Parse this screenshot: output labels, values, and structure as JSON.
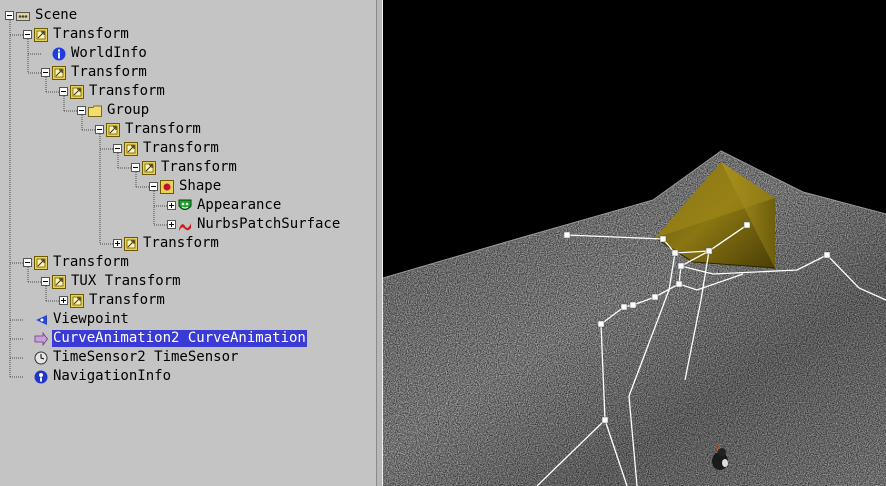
{
  "tree": {
    "nodes": [
      {
        "label": "Scene",
        "icon": "scene-icon",
        "expander": "minus",
        "depth": 0,
        "kind": "scene"
      },
      {
        "label": "Transform",
        "icon": "transform-icon",
        "expander": "minus",
        "depth": 1,
        "kind": "transform"
      },
      {
        "label": "WorldInfo",
        "icon": "info-icon",
        "expander": "none",
        "depth": 2,
        "kind": "info"
      },
      {
        "label": "Transform",
        "icon": "transform-icon",
        "expander": "minus",
        "depth": 2,
        "kind": "transform"
      },
      {
        "label": "Transform",
        "icon": "transform-icon",
        "expander": "minus",
        "depth": 3,
        "kind": "transform"
      },
      {
        "label": "Group",
        "icon": "folder-icon",
        "expander": "minus",
        "depth": 4,
        "kind": "group"
      },
      {
        "label": "Transform",
        "icon": "transform-icon",
        "expander": "minus",
        "depth": 5,
        "kind": "transform"
      },
      {
        "label": "Transform",
        "icon": "transform-icon",
        "expander": "minus",
        "depth": 6,
        "kind": "transform"
      },
      {
        "label": "Transform",
        "icon": "transform-icon",
        "expander": "minus",
        "depth": 7,
        "kind": "transform"
      },
      {
        "label": "Shape",
        "icon": "shape-icon",
        "expander": "minus",
        "depth": 8,
        "kind": "shape"
      },
      {
        "label": "Appearance",
        "icon": "appearance-icon",
        "expander": "plus",
        "depth": 9,
        "kind": "appearance"
      },
      {
        "label": "NurbsPatchSurface",
        "icon": "nurbs-icon",
        "expander": "plus",
        "depth": 9,
        "kind": "nurbs"
      },
      {
        "label": "Transform",
        "icon": "transform-icon",
        "expander": "plus",
        "depth": 6,
        "kind": "transform"
      },
      {
        "label": "Transform",
        "icon": "transform-icon",
        "expander": "minus",
        "depth": 1,
        "kind": "transform"
      },
      {
        "label": "TUX Transform",
        "icon": "transform-icon",
        "expander": "minus",
        "depth": 2,
        "kind": "transform"
      },
      {
        "label": "Transform",
        "icon": "transform-icon",
        "expander": "plus",
        "depth": 3,
        "kind": "transform"
      },
      {
        "label": "Viewpoint",
        "icon": "viewpoint-icon",
        "expander": "none",
        "depth": 1,
        "kind": "viewpoint"
      },
      {
        "label": "CurveAnimation2 CurveAnimation",
        "icon": "curve-animation-icon",
        "expander": "none",
        "depth": 1,
        "kind": "curve",
        "selected": true
      },
      {
        "label": "TimeSensor2 TimeSensor",
        "icon": "clock-icon",
        "expander": "none",
        "depth": 1,
        "kind": "clock"
      },
      {
        "label": "NavigationInfo",
        "icon": "navigation-info-icon",
        "expander": "none",
        "depth": 1,
        "kind": "navinfo"
      }
    ]
  },
  "colors": {
    "panel_bg": "#c4c4c4",
    "selection_bg": "#3a3ad6",
    "selection_fg": "#ffffff",
    "viewport_bg": "#000000",
    "pyramid": "#8a7612",
    "control_path": "#ffffff"
  }
}
